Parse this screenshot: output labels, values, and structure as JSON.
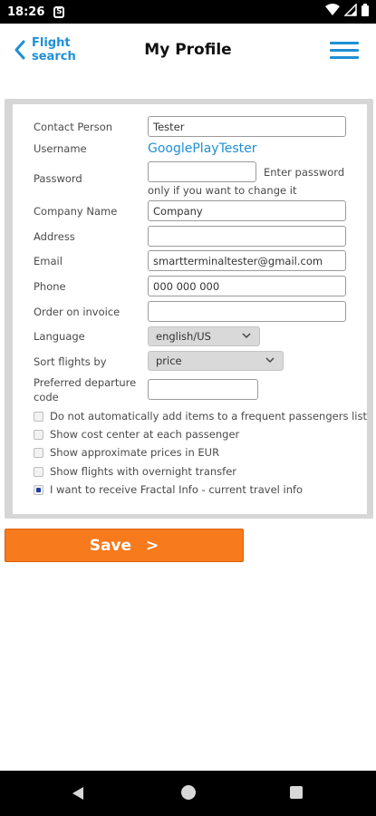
{
  "status_bar": {
    "time": "18:26",
    "notif_icon": "S"
  },
  "header": {
    "back_label": "Flight search",
    "title": "My Profile",
    "accent": "#1e8fd6"
  },
  "form": {
    "contact_person": {
      "label": "Contact Person",
      "value": "Tester"
    },
    "username": {
      "label": "Username",
      "value": "GooglePlayTester"
    },
    "password": {
      "label": "Password",
      "value": "",
      "hint_line1": "Enter password",
      "hint_line2": "only if you want to change it"
    },
    "company_name": {
      "label": "Company Name",
      "value": "Company"
    },
    "address": {
      "label": "Address",
      "value": ""
    },
    "email": {
      "label": "Email",
      "value": "smartterminaltester@gmail.com"
    },
    "phone": {
      "label": "Phone",
      "value": "000 000 000"
    },
    "order_on_invoice": {
      "label": "Order on invoice",
      "value": ""
    },
    "language": {
      "label": "Language",
      "selected": "english/US"
    },
    "sort_flights": {
      "label": "Sort flights by",
      "selected": "price"
    },
    "preferred_departure": {
      "label_line1": "Preferred departure",
      "label_line2": "code",
      "value": ""
    },
    "options": [
      {
        "label": "Do not automatically add items to a frequent passengers list",
        "checked": false
      },
      {
        "label": "Show cost center at each passenger",
        "checked": false
      },
      {
        "label": "Show approximate prices in EUR",
        "checked": false
      },
      {
        "label": "Show flights with overnight transfer",
        "checked": false
      },
      {
        "label": "I want to receive Fractal Info - current travel info",
        "checked": true
      }
    ]
  },
  "save_button": {
    "label": "Save",
    "arrow": ">",
    "color": "#f77a1d"
  }
}
